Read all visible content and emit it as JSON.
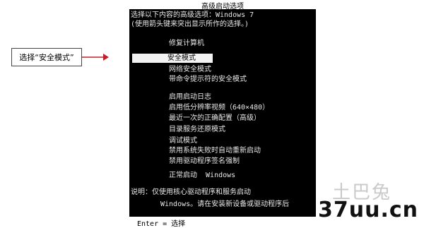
{
  "callout": {
    "label": "选择“安全模式”"
  },
  "screen": {
    "title": "高级启动选项",
    "intro_line1": "选择以下内容的高级选项：Windows 7",
    "intro_line2": "(使用箭头键来突出显示所作的选择。)",
    "repair": "修复计算机",
    "options": [
      "安全模式",
      "网络安全模式",
      "带命令提示符的安全模式",
      "启用启动日志",
      "启用低分辨率视频（640×480）",
      "最近一次的正确配置（高级）",
      "目录服务还原模式",
      "调试模式",
      "禁用系统失败时自动重新启动",
      "禁用驱动程序签名强制",
      "正常启动  Windows"
    ],
    "desc_line1": "说明：仅使用核心驱动程序和服务启动",
    "desc_line2": "Windows。请在安装新设备或驱动程序后"
  },
  "footer": {
    "hint": "Enter = 选择"
  },
  "watermark": {
    "top": "土巴兔",
    "bottom": "37uu.cn"
  },
  "colors": {
    "arrow": "#c0202a",
    "screen_bg": "#000000",
    "highlight_bg": "#f2f2f2"
  }
}
